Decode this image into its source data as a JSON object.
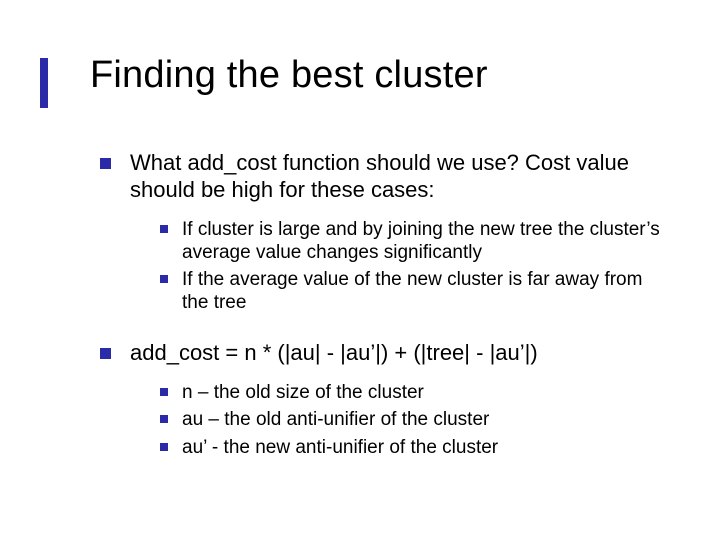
{
  "title": "Finding the best cluster",
  "bullets": {
    "b1": {
      "text": "What add_cost function should we use? Cost value should be high for these cases:",
      "sub": [
        "If cluster is large and by joining the new tree the cluster’s average value changes significantly",
        "If the average value of the new cluster is far away from the tree"
      ]
    },
    "b2": {
      "text": "add_cost = n * (|au| - |au’|) + (|tree| - |au’|)",
      "sub": [
        "n – the old size of the cluster",
        "au – the old anti-unifier of the cluster",
        "au’ - the new anti-unifier of the cluster"
      ]
    }
  }
}
